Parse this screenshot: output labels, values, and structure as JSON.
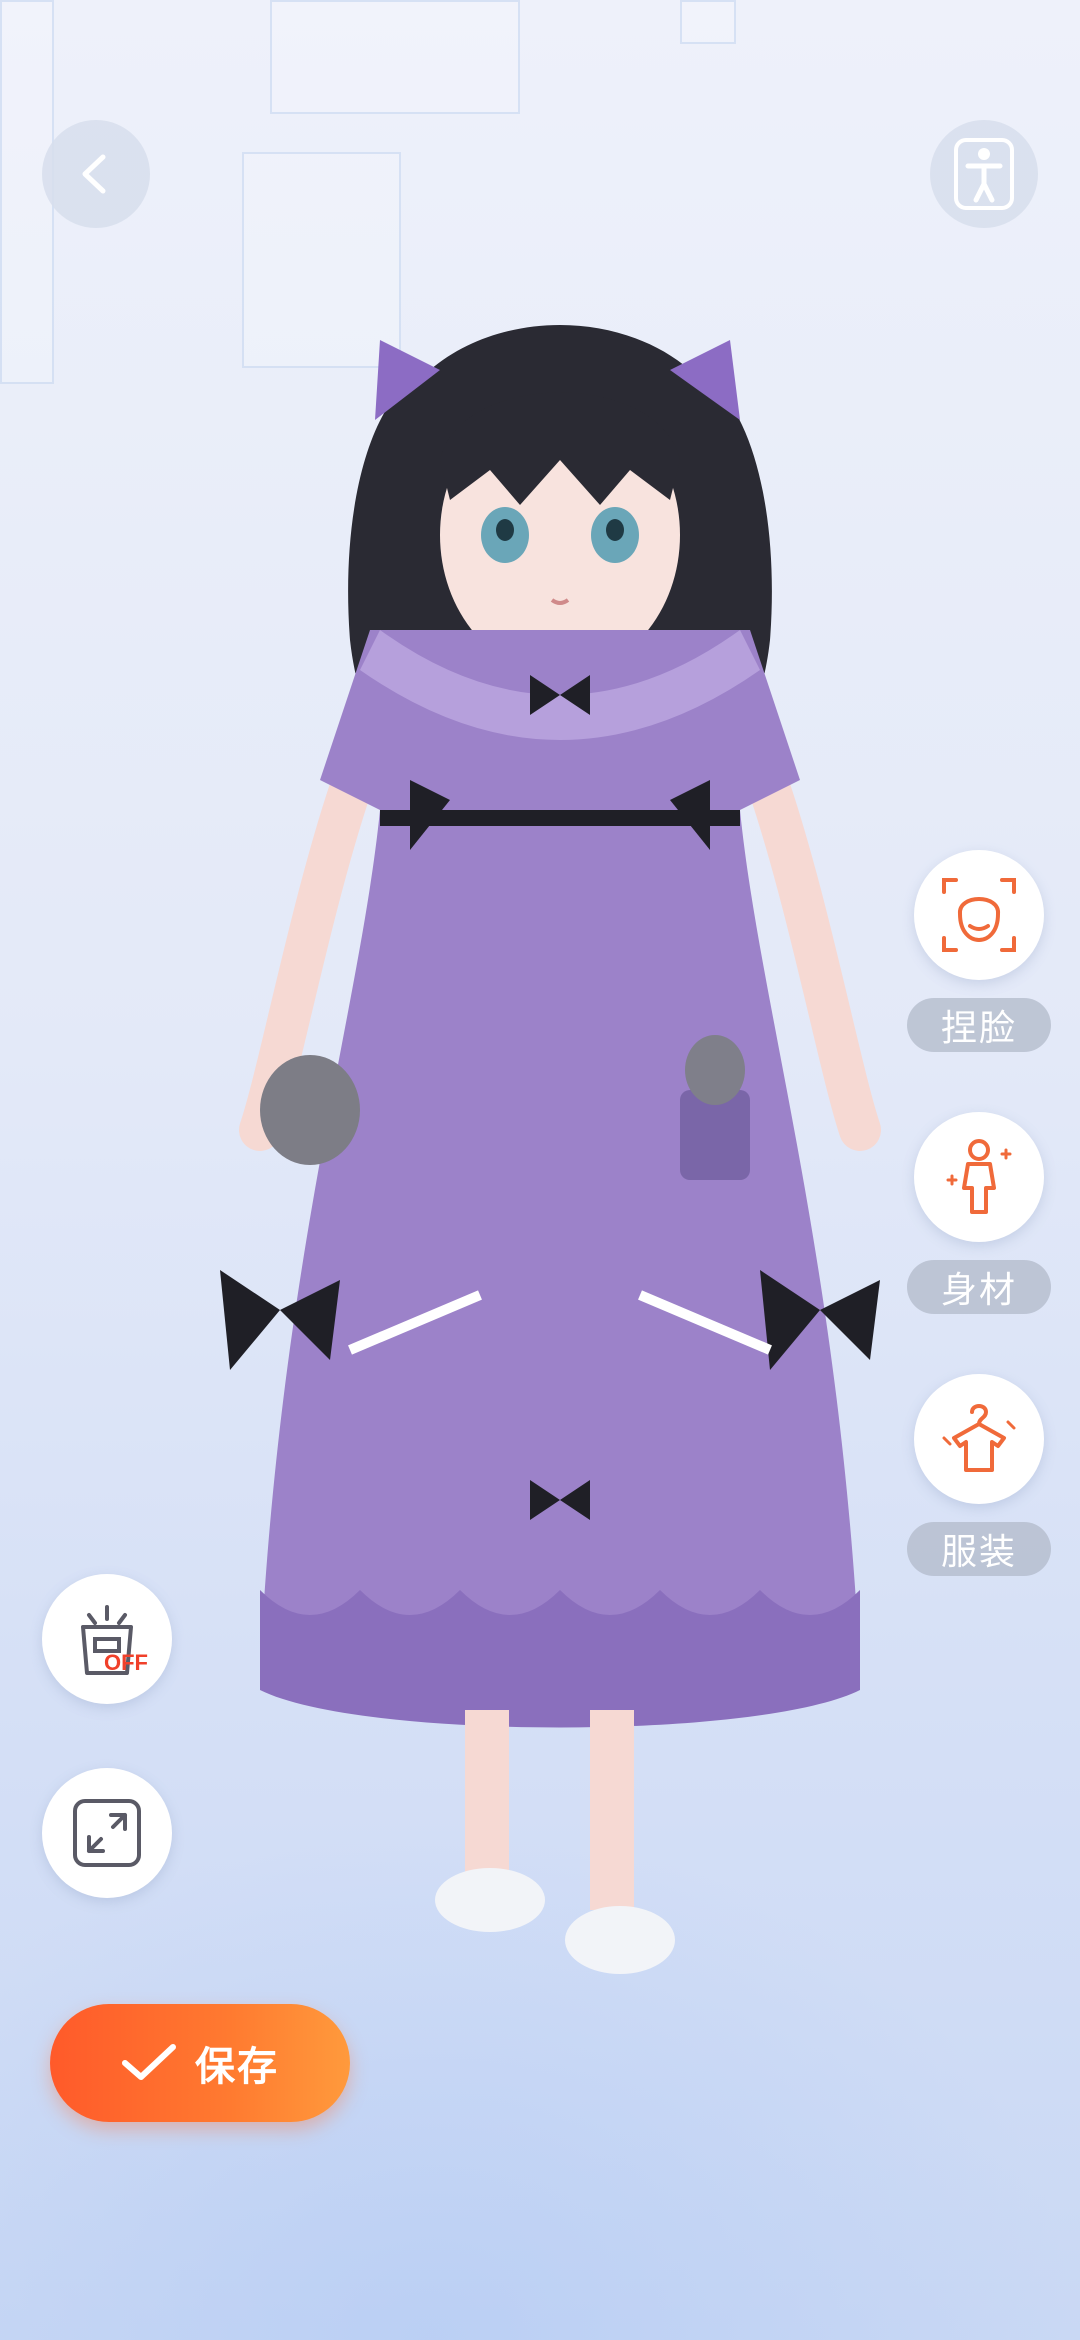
{
  "header": {
    "back_icon": "chevron-left-icon",
    "pose_icon": "standing-figure-icon"
  },
  "side_menu": {
    "items": [
      {
        "label": "捏脸",
        "icon": "face-icon"
      },
      {
        "label": "身材",
        "icon": "body-icon"
      },
      {
        "label": "服装",
        "icon": "hanger-icon"
      }
    ]
  },
  "tools": {
    "stage_toggle_icon": "stage-light-icon",
    "stage_toggle_state": "OFF",
    "expand_icon": "expand-icon"
  },
  "save_button": {
    "label": "保存",
    "icon": "check-icon"
  },
  "colors": {
    "accent": "#ff6a30",
    "icon_orange": "#f06a3a",
    "dress": "#9c82c9",
    "background": "#e3e9f8"
  }
}
